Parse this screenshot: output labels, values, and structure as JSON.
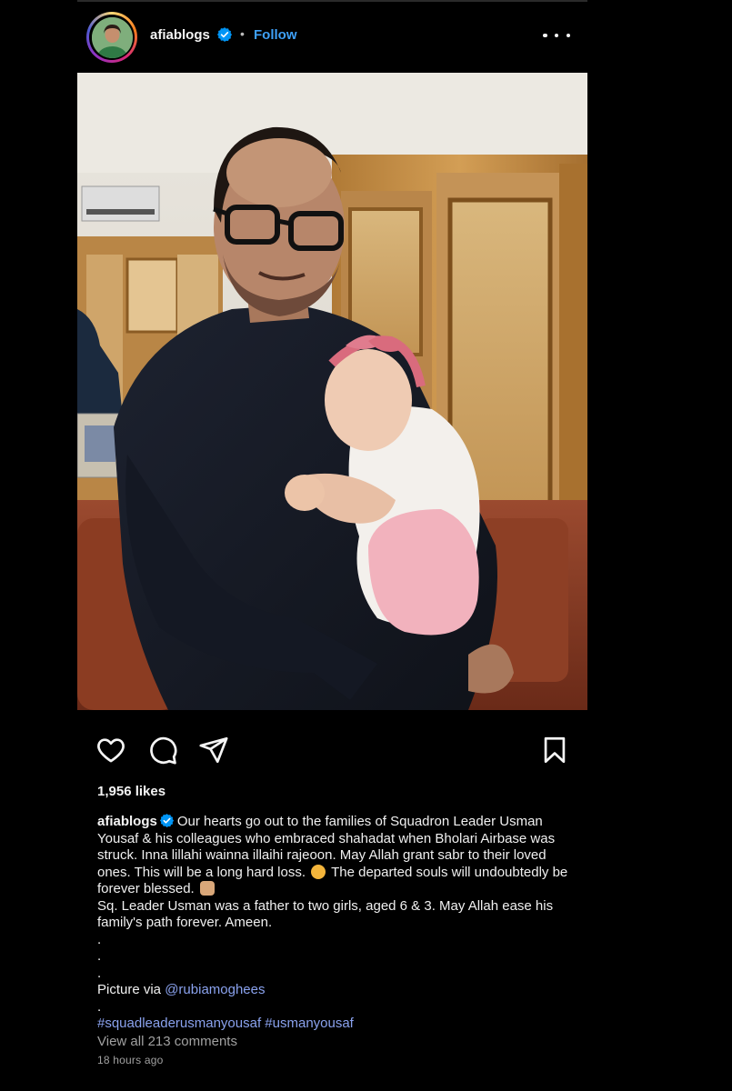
{
  "header": {
    "username": "afiablogs",
    "separator": "•",
    "follow_label": "Follow",
    "more_icon": "more-horizontal-icon"
  },
  "actions": {
    "like_icon": "heart-icon",
    "comment_icon": "comment-icon",
    "share_icon": "paper-plane-icon",
    "save_icon": "bookmark-icon"
  },
  "likes": "1,956 likes",
  "caption": {
    "username": "afiablogs",
    "text_part1": "Our hearts go out to the families of Squadron Leader Usman Yousaf & his colleagues who embraced shahadat when Bholari Airbase was struck. Inna lillahi wainna illaihi rajeoon. May Allah grant sabr to their loved ones. This will be a long hard loss.",
    "text_part2": "The departed souls will undoubtedly be forever blessed.",
    "text_line2": "Sq. Leader Usman was a father to two girls, aged 6 & 3. May Allah ease his family's path forever. Ameen.",
    "dot1": ".",
    "dot2": ".",
    "dot3": ".",
    "picture_via": "Picture via",
    "mention": "@rubiamoghees",
    "dot4": ".",
    "hashtags": "#squadleaderusmanyousaf #usmanyousaf"
  },
  "view_all": "View all 213 comments",
  "timestamp": "18 hours ago",
  "colors": {
    "background": "#000000",
    "follow_blue": "#3ea0f8",
    "verified_blue": "#0095f6",
    "link": "#8aa2ee",
    "muted": "#a0a0a0"
  }
}
